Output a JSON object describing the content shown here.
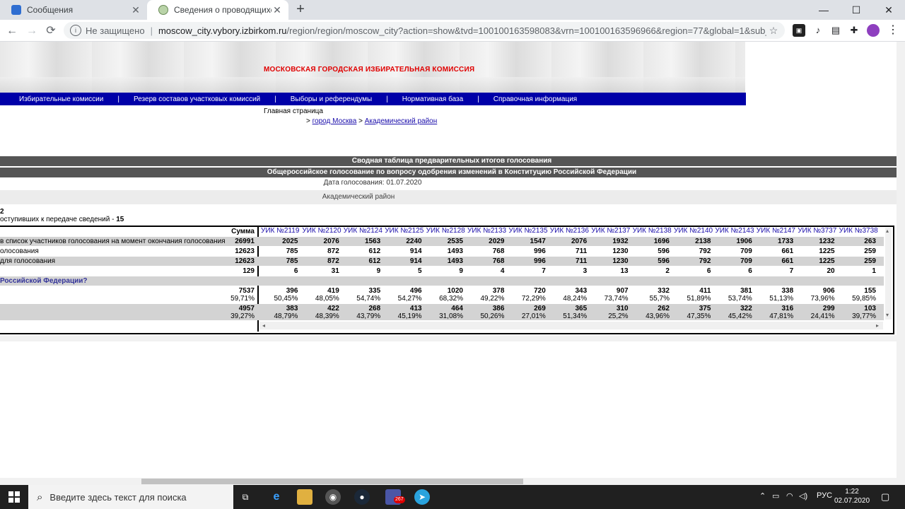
{
  "browser": {
    "tabs": [
      {
        "title": "Сообщения",
        "close": "✕"
      },
      {
        "title": "Сведения о проводящихся выб",
        "close": "✕"
      }
    ],
    "new_tab": "+",
    "window_controls": {
      "minimize": "—",
      "maximize": "☐",
      "close": "✕"
    },
    "nav": {
      "back": "←",
      "forward": "→",
      "reload": "⟳"
    },
    "security": "Не защищено",
    "url_host": "moscow_city.vybory.izbirkom.ru",
    "url_path": "/region/region/moscow_city?action=show&tvd=100100163598083&vrn=100100163596966&region=77&global=1&sub_region=77&p...",
    "star": "☆"
  },
  "page": {
    "site_title": "МОСКОВСКАЯ ГОРОДСКАЯ ИЗБИРАТЕЛЬНАЯ КОМИССИЯ",
    "nav": [
      "Избирательные комиссии",
      "Резерв составов участковых комиссий",
      "Выборы и референдумы",
      "Нормативная база",
      "Справочная информация"
    ],
    "home": "Главная страница",
    "breadcrumb": {
      "sep": ">",
      "city": "город Москва",
      "district": "Академический район"
    },
    "summary_title": "Сводная таблица предварительных итогов голосования",
    "vote_title": "Общероссийское голосование по вопросу одобрения изменений в Конституцию Российской Федерации",
    "vote_date": "Дата голосования:  01.07.2020",
    "district_name": "Академический район",
    "stat_num": "2",
    "stat_line_prefix": "оступивших к передаче сведений - ",
    "stat_line_value": "15"
  },
  "table": {
    "sum_header": "Сумма",
    "uik": [
      "УИК №2119",
      "УИК №2120",
      "УИК №2124",
      "УИК №2125",
      "УИК №2128",
      "УИК №2133",
      "УИК №2135",
      "УИК №2136",
      "УИК №2137",
      "УИК №2138",
      "УИК №2140",
      "УИК №2143",
      "УИК №2147",
      "УИК №3737",
      "УИК №3738"
    ],
    "rows": [
      {
        "label": "в список участников голосования на момент окончания голосования",
        "sum": "26991",
        "values": [
          "2025",
          "2076",
          "1563",
          "2240",
          "2535",
          "2029",
          "1547",
          "2076",
          "1932",
          "1696",
          "2138",
          "1906",
          "1733",
          "1232",
          "263"
        ]
      },
      {
        "label": "олосования",
        "sum": "12623",
        "values": [
          "785",
          "872",
          "612",
          "914",
          "1493",
          "768",
          "996",
          "711",
          "1230",
          "596",
          "792",
          "709",
          "661",
          "1225",
          "259"
        ]
      },
      {
        "label": "для голосования",
        "sum": "12623",
        "values": [
          "785",
          "872",
          "612",
          "914",
          "1493",
          "768",
          "996",
          "711",
          "1230",
          "596",
          "792",
          "709",
          "661",
          "1225",
          "259"
        ]
      },
      {
        "label": "",
        "sum": "129",
        "values": [
          "6",
          "31",
          "9",
          "5",
          "9",
          "4",
          "7",
          "3",
          "13",
          "2",
          "6",
          "6",
          "7",
          "20",
          "1"
        ]
      }
    ],
    "question": "Российской Федерации?",
    "answers": [
      {
        "sum": "7537",
        "sum_pct": "59,71%",
        "values": [
          "396",
          "419",
          "335",
          "496",
          "1020",
          "378",
          "720",
          "343",
          "907",
          "332",
          "411",
          "381",
          "338",
          "906",
          "155"
        ],
        "pcts": [
          "50,45%",
          "48,05%",
          "54,74%",
          "54,27%",
          "68,32%",
          "49,22%",
          "72,29%",
          "48,24%",
          "73,74%",
          "55,7%",
          "51,89%",
          "53,74%",
          "51,13%",
          "73,96%",
          "59,85%"
        ]
      },
      {
        "sum": "4957",
        "sum_pct": "39,27%",
        "values": [
          "383",
          "422",
          "268",
          "413",
          "464",
          "386",
          "269",
          "365",
          "310",
          "262",
          "375",
          "322",
          "316",
          "299",
          "103"
        ],
        "pcts": [
          "48,79%",
          "48,39%",
          "43,79%",
          "45,19%",
          "31,08%",
          "50,26%",
          "27,01%",
          "51,34%",
          "25,2%",
          "43,96%",
          "47,35%",
          "45,42%",
          "47,81%",
          "24,41%",
          "39,77%"
        ]
      }
    ],
    "scroll_left": "◂",
    "scroll_right": "▸",
    "scroll_up": "▴",
    "scroll_down": "▾"
  },
  "taskbar": {
    "search_placeholder": "Введите здесь текст для поиска",
    "lang": "РУС",
    "time": "1:22",
    "date": "02.07.2020",
    "badge_steam": "267"
  }
}
